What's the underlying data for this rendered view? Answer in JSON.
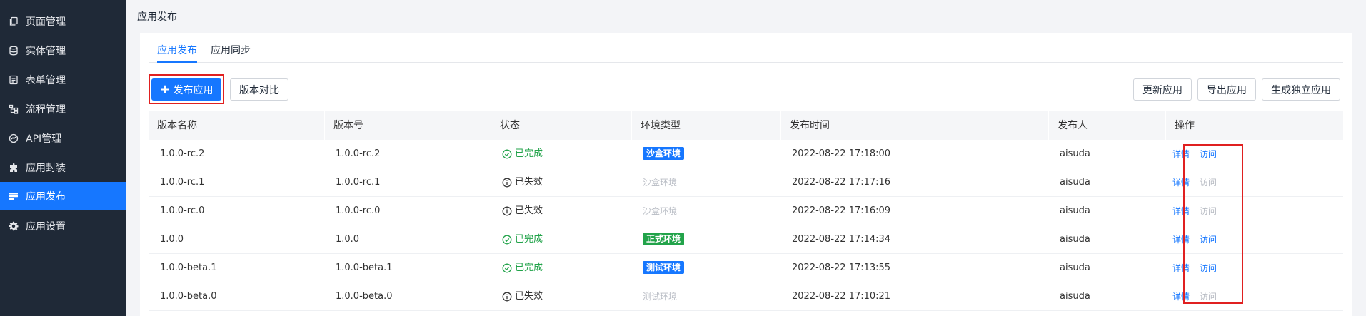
{
  "sidebar": {
    "items": [
      {
        "label": "页面管理",
        "icon": "copy-icon",
        "active": false
      },
      {
        "label": "实体管理",
        "icon": "database-icon",
        "active": false
      },
      {
        "label": "表单管理",
        "icon": "form-icon",
        "active": false
      },
      {
        "label": "流程管理",
        "icon": "flow-icon",
        "active": false
      },
      {
        "label": "API管理",
        "icon": "api-icon",
        "active": false
      },
      {
        "label": "应用封装",
        "icon": "puzzle-icon",
        "active": false
      },
      {
        "label": "应用发布",
        "icon": "publish-icon",
        "active": true
      },
      {
        "label": "应用设置",
        "icon": "gear-icon",
        "active": false
      }
    ]
  },
  "page": {
    "title": "应用发布"
  },
  "tabs": [
    {
      "label": "应用发布",
      "active": true
    },
    {
      "label": "应用同步",
      "active": false
    }
  ],
  "toolbar": {
    "publish_label": "发布应用",
    "compare_label": "版本对比",
    "update_label": "更新应用",
    "export_label": "导出应用",
    "standalone_label": "生成独立应用"
  },
  "table": {
    "columns": [
      "版本名称",
      "版本号",
      "状态",
      "环境类型",
      "发布时间",
      "发布人",
      "操作"
    ],
    "rows": [
      {
        "name": "1.0.0-rc.2",
        "version": "1.0.0-rc.2",
        "status": "已完成",
        "status_ok": true,
        "env": "沙盒环境",
        "env_active": true,
        "env_color": "#1677ff",
        "time": "2022-08-22 17:18:00",
        "publisher": "aisuda",
        "detail": "详情",
        "visit": "访问",
        "visit_enabled": true
      },
      {
        "name": "1.0.0-rc.1",
        "version": "1.0.0-rc.1",
        "status": "已失效",
        "status_ok": false,
        "env": "沙盒环境",
        "env_active": false,
        "env_color": "#1677ff",
        "time": "2022-08-22 17:17:16",
        "publisher": "aisuda",
        "detail": "详情",
        "visit": "访问",
        "visit_enabled": false
      },
      {
        "name": "1.0.0-rc.0",
        "version": "1.0.0-rc.0",
        "status": "已失效",
        "status_ok": false,
        "env": "沙盒环境",
        "env_active": false,
        "env_color": "#1677ff",
        "time": "2022-08-22 17:16:09",
        "publisher": "aisuda",
        "detail": "详情",
        "visit": "访问",
        "visit_enabled": false
      },
      {
        "name": "1.0.0",
        "version": "1.0.0",
        "status": "已完成",
        "status_ok": true,
        "env": "正式环境",
        "env_active": true,
        "env_color": "#22a34a",
        "time": "2022-08-22 17:14:34",
        "publisher": "aisuda",
        "detail": "详情",
        "visit": "访问",
        "visit_enabled": true
      },
      {
        "name": "1.0.0-beta.1",
        "version": "1.0.0-beta.1",
        "status": "已完成",
        "status_ok": true,
        "env": "测试环境",
        "env_active": true,
        "env_color": "#1677ff",
        "time": "2022-08-22 17:13:55",
        "publisher": "aisuda",
        "detail": "详情",
        "visit": "访问",
        "visit_enabled": true
      },
      {
        "name": "1.0.0-beta.0",
        "version": "1.0.0-beta.0",
        "status": "已失效",
        "status_ok": false,
        "env": "测试环境",
        "env_active": false,
        "env_color": "#1677ff",
        "time": "2022-08-22 17:10:21",
        "publisher": "aisuda",
        "detail": "详情",
        "visit": "访问",
        "visit_enabled": false
      }
    ]
  },
  "colors": {
    "sidebar_bg": "#1f2937",
    "accent": "#1677ff",
    "success": "#22a34a",
    "muted": "#b8bcc4",
    "highlight": "#e02020"
  }
}
